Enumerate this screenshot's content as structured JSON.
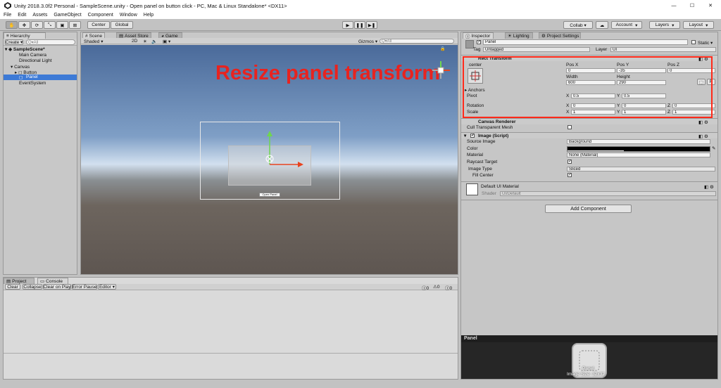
{
  "titlebar": {
    "title": "Unity 2018.3.0f2 Personal - SampleScene.unity - Open panel on button click - PC, Mac & Linux Standalone* <DX11>",
    "minimize": "—",
    "maximize": "☐",
    "close": "✕"
  },
  "menu": [
    "File",
    "Edit",
    "Assets",
    "GameObject",
    "Component",
    "Window",
    "Help"
  ],
  "toolbar": {
    "center": "Center",
    "global": "Global",
    "collab": "Collab ▾",
    "account": "Account",
    "layers": "Layers",
    "layout": "Layout"
  },
  "hierarchy": {
    "tab": "Hierarchy",
    "create": "Create ▾",
    "search_placeholder": "Q▾All",
    "scene": "SampleScene*",
    "items": [
      "Main Camera",
      "Directional Light",
      "Canvas",
      "Button",
      "Panel",
      "EventSystem"
    ]
  },
  "scene": {
    "tabs": [
      "Scene",
      "Asset Store",
      "Game"
    ],
    "shading": "Shaded",
    "mode2d": "2D",
    "gizmos": "Gizmos ▾",
    "search_placeholder": "Q▾All",
    "annotation": "Resize panel transform",
    "button_text": "Open Panel"
  },
  "bottom": {
    "tabs": [
      "Project",
      "Console"
    ],
    "buttons": [
      "Clear",
      "Collapse",
      "Clear on Play",
      "Error Pause",
      "Editor ▾"
    ],
    "counts": [
      "0",
      "0",
      "0"
    ]
  },
  "inspector": {
    "tabs": [
      "Inspector",
      "Lighting",
      "Project Settings"
    ],
    "object_name": "Panel",
    "static_label": "Static ▾",
    "tag_label": "Tag",
    "tag_value": "Untagged",
    "layer_label": "Layer",
    "layer_value": "UI",
    "rect": {
      "title": "Rect Transform",
      "anchor_preset": "center",
      "col_headers": [
        "Pos X",
        "Pos Y",
        "Pos Z"
      ],
      "pos": [
        "0",
        "-35",
        "0"
      ],
      "width_label": "Width",
      "height_label": "Height",
      "width": "600",
      "height": "290",
      "anchors": "Anchors",
      "pivot": "Pivot",
      "pivot_x": "0.5",
      "pivot_y": "0.5",
      "rotation": "Rotation",
      "rot": [
        "0",
        "0",
        "0"
      ],
      "scale": "Scale",
      "scl": [
        "1",
        "1",
        "1"
      ],
      "axes": [
        "X",
        "Y",
        "Z"
      ]
    },
    "canvas_renderer": {
      "title": "Canvas Renderer",
      "cull": "Cull Transparent Mesh"
    },
    "image": {
      "title": "Image (Script)",
      "source_image_label": "Source Image",
      "source_image": "Background",
      "color_label": "Color",
      "material_label": "Material",
      "material": "None (Material)",
      "raycast_label": "Raycast Target",
      "image_type_label": "Image Type",
      "image_type": "Sliced",
      "fill_center_label": "Fill Center"
    },
    "material": {
      "name": "Default UI Material",
      "shader_label": "Shader",
      "shader": "UI/Default"
    },
    "add_component": "Add Component",
    "preview": {
      "title": "Panel",
      "asset_name": "Panel",
      "size_label": "Image Size: 32x32"
    }
  },
  "colors": {
    "annotation": "#e8231f",
    "highlight_box": "#ff2a1a",
    "selection": "#3d7ad6"
  }
}
